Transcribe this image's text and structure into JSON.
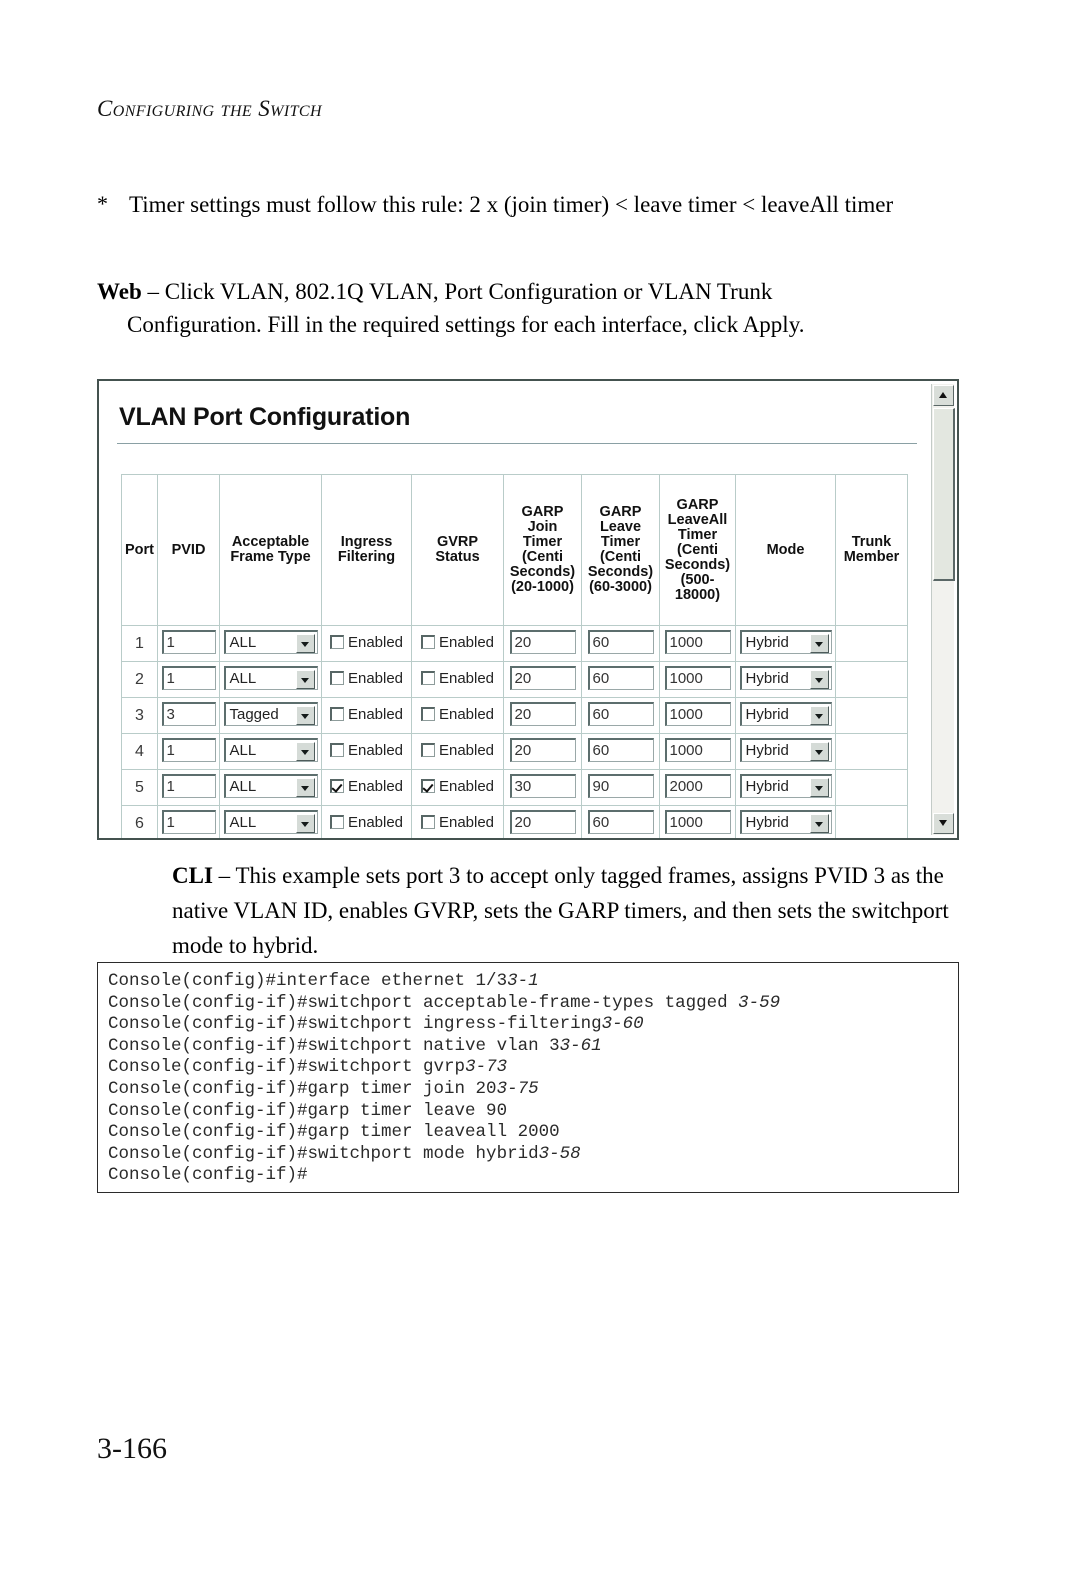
{
  "page": {
    "running_head": "Configuring the Switch",
    "folio": "3-166"
  },
  "note": {
    "marker": "*",
    "text": "Timer settings must follow this rule: 2 x (join timer) < leave timer < leaveAll timer"
  },
  "web_paragraph": {
    "lead": "Web",
    "line1": " – Click VLAN, 802.1Q VLAN, Port Configuration or VLAN Trunk",
    "line2": "Configuration. Fill in the required settings for each interface, click Apply."
  },
  "screenshot": {
    "title": "VLAN Port Configuration",
    "columns": [
      "Port",
      "PVID",
      "Acceptable Frame Type",
      "Ingress Filtering",
      "GVRP Status",
      "GARP Join Timer (Centi Seconds) (20-1000)",
      "GARP Leave Timer (Centi Seconds) (60-3000)",
      "GARP LeaveAll Timer (Centi Seconds) (500-18000)",
      "Mode",
      "Trunk Member"
    ],
    "column_lines": {
      "port": [
        "Port"
      ],
      "pvid": [
        "PVID"
      ],
      "acceptable_frame_type": [
        "Acceptable",
        "Frame Type"
      ],
      "ingress_filtering": [
        "Ingress",
        "Filtering"
      ],
      "gvrp_status": [
        "GVRP",
        "Status"
      ],
      "garp_join": [
        "GARP",
        "Join",
        "Timer",
        "(Centi",
        "Seconds)",
        "(20-1000)"
      ],
      "garp_leave": [
        "GARP",
        "Leave",
        "Timer",
        "(Centi",
        "Seconds)",
        "(60-3000)"
      ],
      "garp_leaveall": [
        "GARP",
        "LeaveAll",
        "Timer",
        "(Centi",
        "Seconds)",
        "(500-",
        "18000)"
      ],
      "mode": [
        "Mode"
      ],
      "trunk_member": [
        "Trunk",
        "Member"
      ]
    },
    "checkbox_label": "Enabled",
    "rows": [
      {
        "port": "1",
        "pvid": "1",
        "frame_type": "ALL",
        "ingress_filtering": false,
        "gvrp_status": false,
        "join_timer": "20",
        "leave_timer": "60",
        "leaveall_timer": "1000",
        "mode": "Hybrid",
        "trunk_member": ""
      },
      {
        "port": "2",
        "pvid": "1",
        "frame_type": "ALL",
        "ingress_filtering": false,
        "gvrp_status": false,
        "join_timer": "20",
        "leave_timer": "60",
        "leaveall_timer": "1000",
        "mode": "Hybrid",
        "trunk_member": ""
      },
      {
        "port": "3",
        "pvid": "3",
        "frame_type": "Tagged",
        "ingress_filtering": false,
        "gvrp_status": false,
        "join_timer": "20",
        "leave_timer": "60",
        "leaveall_timer": "1000",
        "mode": "Hybrid",
        "trunk_member": ""
      },
      {
        "port": "4",
        "pvid": "1",
        "frame_type": "ALL",
        "ingress_filtering": false,
        "gvrp_status": false,
        "join_timer": "20",
        "leave_timer": "60",
        "leaveall_timer": "1000",
        "mode": "Hybrid",
        "trunk_member": ""
      },
      {
        "port": "5",
        "pvid": "1",
        "frame_type": "ALL",
        "ingress_filtering": true,
        "gvrp_status": true,
        "join_timer": "30",
        "leave_timer": "90",
        "leaveall_timer": "2000",
        "mode": "Hybrid",
        "trunk_member": ""
      },
      {
        "port": "6",
        "pvid": "1",
        "frame_type": "ALL",
        "ingress_filtering": false,
        "gvrp_status": false,
        "join_timer": "20",
        "leave_timer": "60",
        "leaveall_timer": "1000",
        "mode": "Hybrid",
        "trunk_member": ""
      }
    ]
  },
  "cli_paragraph": {
    "lead": "CLI",
    "text": " – This example sets port 3 to accept only tagged frames, assigns PVID 3 as the native VLAN ID, enables GVRP, sets the GARP timers, and then sets the switchport mode to hybrid."
  },
  "console": {
    "lines": [
      {
        "cmd": "Console(config)#interface ethernet 1/3",
        "ref": "3-1"
      },
      {
        "cmd": "Console(config-if)#switchport acceptable-frame-types tagged ",
        "ref": "3-59"
      },
      {
        "cmd": "Console(config-if)#switchport ingress-filtering",
        "ref": "3-60"
      },
      {
        "cmd": "Console(config-if)#switchport native vlan 3",
        "ref": "3-61"
      },
      {
        "cmd": "Console(config-if)#switchport gvrp",
        "ref": "3-73"
      },
      {
        "cmd": "Console(config-if)#garp timer join 20",
        "ref": "3-75"
      },
      {
        "cmd": "Console(config-if)#garp timer leave 90",
        "ref": ""
      },
      {
        "cmd": "Console(config-if)#garp timer leaveall 2000",
        "ref": ""
      },
      {
        "cmd": "Console(config-if)#switchport mode hybrid",
        "ref": "3-58"
      },
      {
        "cmd": "Console(config-if)#",
        "ref": ""
      }
    ]
  }
}
